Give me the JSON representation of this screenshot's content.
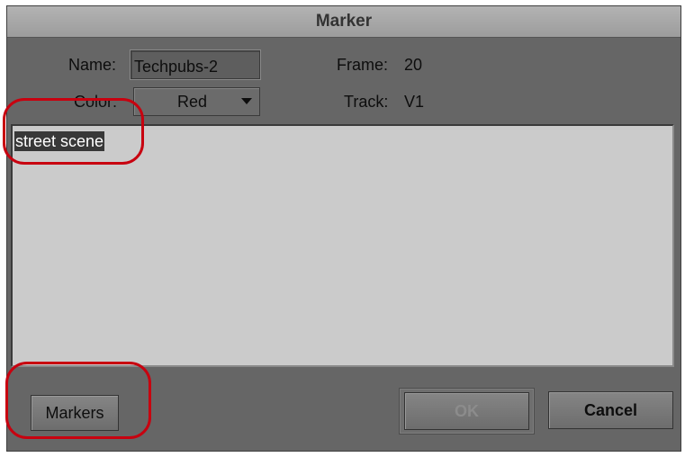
{
  "dialog": {
    "title": "Marker",
    "name_label": "Name:",
    "name_value": "Techpubs-2",
    "color_label": "Color:",
    "color_value": "Red",
    "frame_label": "Frame:",
    "frame_value": "20",
    "track_label": "Track:",
    "track_value": "V1",
    "comment_text": "street scene"
  },
  "buttons": {
    "markers": "Markers",
    "ok": "OK",
    "cancel": "Cancel"
  },
  "icons": {
    "color_dropdown": "chevron-down-icon"
  },
  "colors": {
    "dialog_bg": "#666666",
    "titlebar": "#a6a6a6",
    "comment_bg": "#cbcbcb",
    "selection_bg": "#383838",
    "annotation_ring": "#c8000f"
  }
}
